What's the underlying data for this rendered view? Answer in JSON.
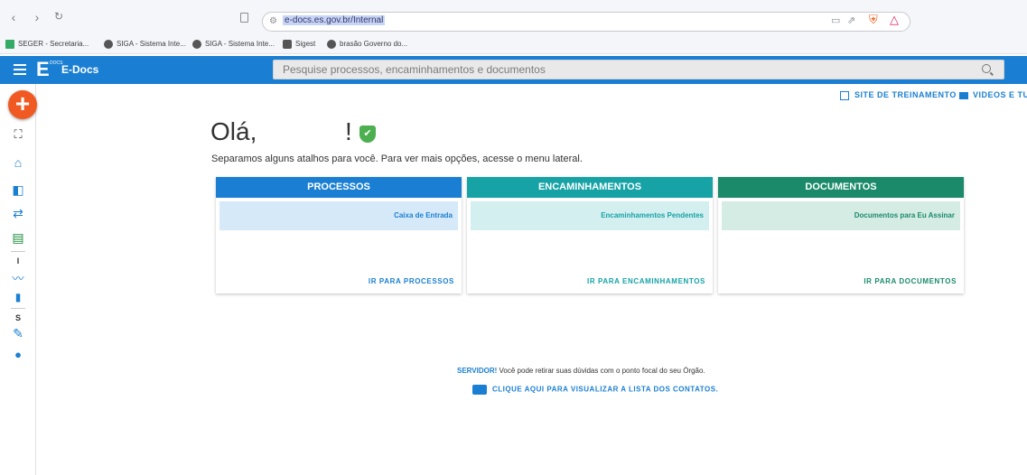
{
  "browser": {
    "url": "e-docs.es.gov.br/Internal",
    "bookmarks": [
      "SEGER - Secretaria...",
      "SIGA - Sistema Inte...",
      "SIGA - Sistema Inte...",
      "Sigest",
      "brasão Governo do..."
    ]
  },
  "app": {
    "brand": "E-Docs",
    "logo_letter": "E",
    "logo_sub": "DOCS",
    "search_placeholder": "Pesquise processos, encaminhamentos e documentos",
    "add_label": "+"
  },
  "top_links": {
    "training": "SITE DE TREINAMENTO",
    "videos": "VIDEOS E TU"
  },
  "sidebar": {
    "letters": [
      "I",
      "S"
    ]
  },
  "greeting": {
    "hello": "Olá,",
    "excl": "!",
    "subtitle": "Separamos alguns atalhos para você. Para ver mais opções, acesse o menu lateral."
  },
  "cards": [
    {
      "title": "PROCESSOS",
      "item": "Caixa de Entrada",
      "link": "IR PARA PROCESSOS",
      "color": "#1a7fd2",
      "row_bg": "#d6e9f8"
    },
    {
      "title": "ENCAMINHAMENTOS",
      "item": "Encaminhamentos Pendentes",
      "link": "IR PARA ENCAMINHAMENTOS",
      "color": "#17a2a6",
      "row_bg": "#d3efef"
    },
    {
      "title": "DOCUMENTOS",
      "item": "Documentos para Eu Assinar",
      "link": "IR PARA DOCUMENTOS",
      "color": "#1a8a6a",
      "row_bg": "#d5ece4"
    }
  ],
  "footer": {
    "servidor": "SERVIDOR!",
    "message": " Você pode retirar suas dúvidas com o ponto focal do seu Órgão.",
    "contacts_link": "CLIQUE AQUI PARA VISUALIZAR A LISTA DOS CONTATOS."
  }
}
